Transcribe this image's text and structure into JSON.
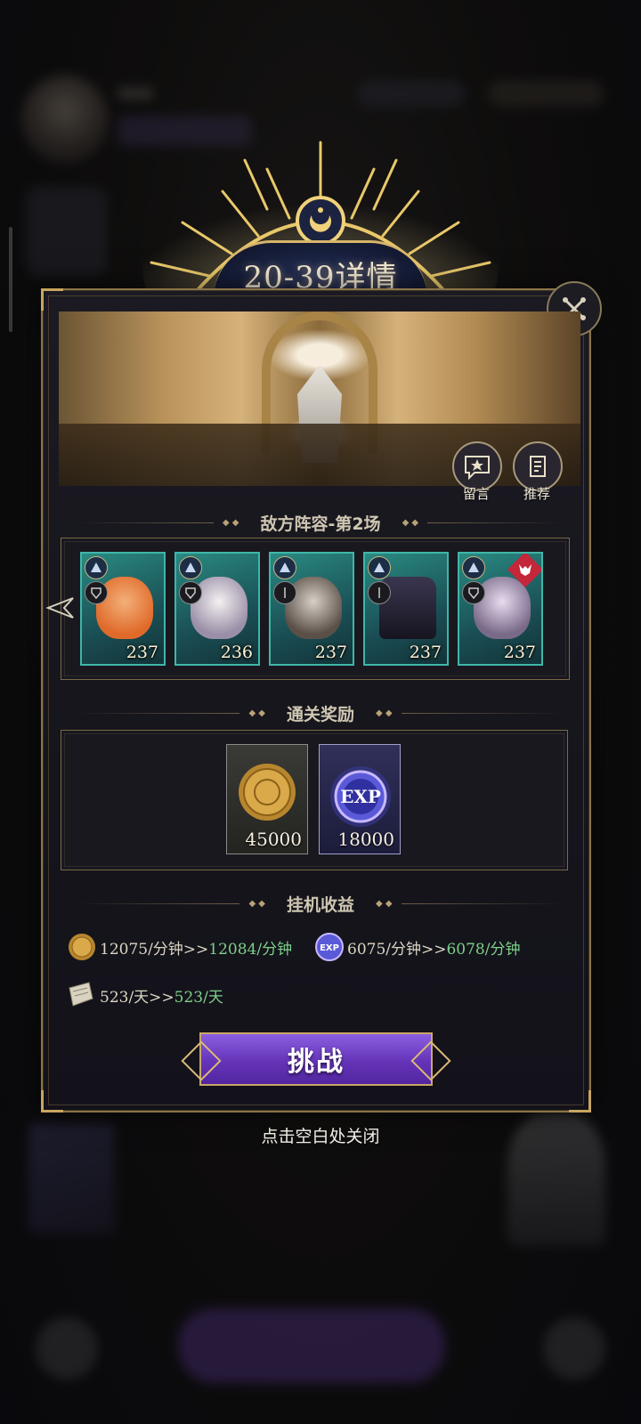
{
  "dialog": {
    "title": "20-39详情",
    "close_icon": "close-x-icon"
  },
  "scene_buttons": [
    {
      "label": "留言",
      "icon": "message-star-icon"
    },
    {
      "label": "推荐",
      "icon": "recommend-icon"
    }
  ],
  "enemy": {
    "title": "敌方阵容-第2场",
    "heroes": [
      {
        "level": "237",
        "color": "#e8984a"
      },
      {
        "level": "236",
        "color": "#d8d4dc"
      },
      {
        "level": "237",
        "color": "#b8b0a8"
      },
      {
        "level": "237",
        "color": "#3a3650"
      },
      {
        "level": "237",
        "color": "#c8b8d8",
        "boss": true
      }
    ]
  },
  "rewards": {
    "title": "通关奖励",
    "items": [
      {
        "name": "gold-coin",
        "amount": "45000"
      },
      {
        "name": "exp",
        "label": "EXP",
        "amount": "18000"
      }
    ]
  },
  "idle": {
    "title": "挂机收益",
    "gold": {
      "from": "12075/分钟>>",
      "to": "12084/分钟"
    },
    "exp": {
      "label": "EXP",
      "from": "6075/分钟>>",
      "to": "6078/分钟"
    },
    "scroll": {
      "from": "523/天>>",
      "to": "523/天"
    }
  },
  "challenge_label": "挑战",
  "close_hint": "点击空白处关闭",
  "colors": {
    "gold": "#c9a55f",
    "green_value": "#7ed08a",
    "button_purple": "#6434b8",
    "card_teal": "#3fb6a8"
  }
}
